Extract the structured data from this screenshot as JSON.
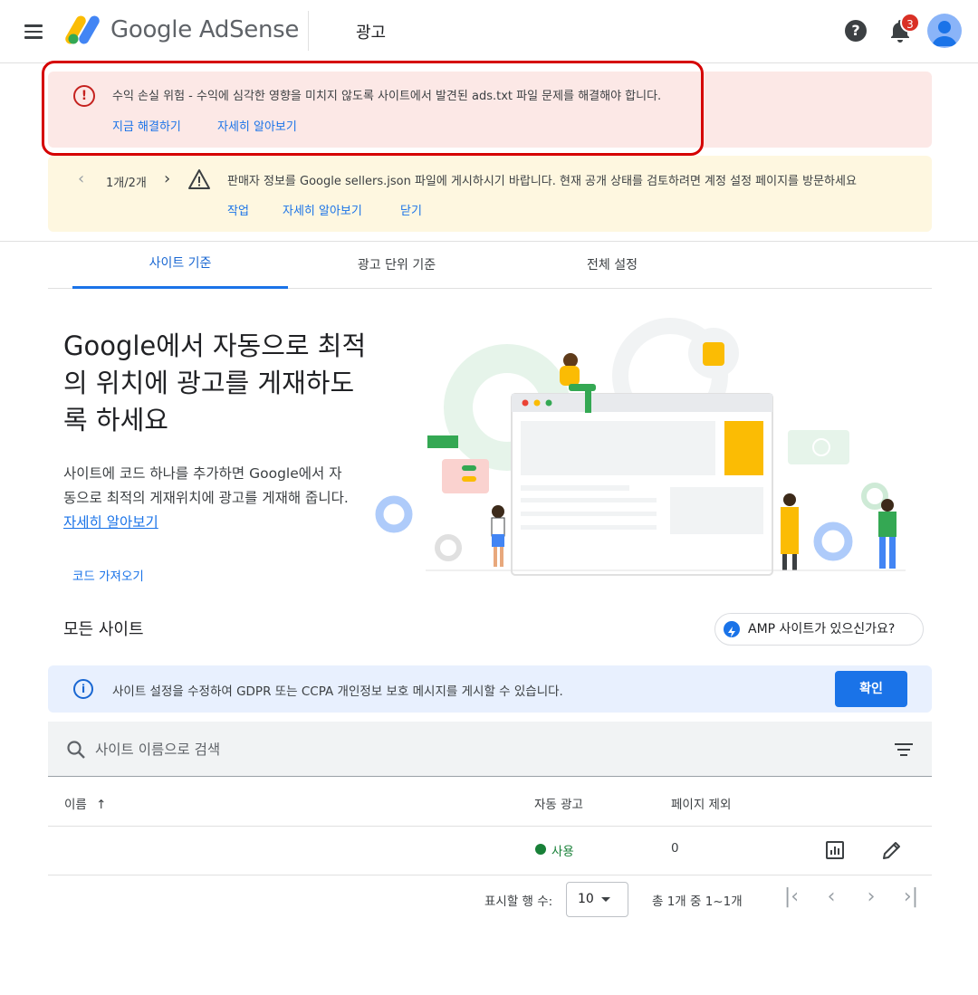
{
  "header": {
    "app_name": "Google AdSense",
    "page_title": "광고",
    "help_icon": "help-circle-icon",
    "notification_count": "3",
    "colors": {
      "logo_yellow": "#fbbc04",
      "logo_blue": "#4285f4",
      "badge_red": "#d93025"
    }
  },
  "alerts": {
    "error": {
      "icon": "error-circle-icon",
      "message": "수익 손실 위험 - 수익에 심각한 영향을 미치지 않도록 사이트에서 발견된 ads.txt 파일 문제를 해결해야 합니다.",
      "fix_link": "지금 해결하기",
      "learn_link": "자세히 알아보기",
      "color": "#fce8e6"
    },
    "warning": {
      "icon": "warning-triangle-icon",
      "pager": "1개/2개",
      "message": "판매자 정보를 Google sellers.json 파일에 게시하시기 바랍니다. 현재 공개 상태를 검토하려면 계정 설정 페이지를 방문하세요",
      "action_link": "작업",
      "learn_link": "자세히 알아보기",
      "close_link": "닫기",
      "color": "#fef7e0"
    }
  },
  "tabs": [
    {
      "label": "사이트 기준",
      "active": true
    },
    {
      "label": "광고 단위 기준",
      "active": false
    },
    {
      "label": "전체 설정",
      "active": false
    }
  ],
  "hero": {
    "title": "Google에서 자동으로 최적의 위치에 광고를 게재하도록 하세요",
    "description": "사이트에 코드 하나를 추가하면 Google에서 자동으로 최적의 게재위치에 광고를 게재해 줍니다.",
    "learn_link": "자세히 알아보기",
    "code_link": "코드 가져오기"
  },
  "sites": {
    "title": "모든 사이트",
    "amp_button": "AMP 사이트가 있으신가요?",
    "info_message": "사이트 설정을 수정하여 GDPR 또는 CCPA 개인정보 보호 메시지를 게시할 수 있습니다.",
    "confirm_button": "확인",
    "search_placeholder": "사이트 이름으로 검색",
    "columns": {
      "name": "이름",
      "auto_ads": "자동 광고",
      "excluded_pages": "페이지 제외"
    },
    "rows": [
      {
        "name": "",
        "auto_ads": "사용",
        "excluded_pages": "0"
      }
    ]
  },
  "pagination": {
    "rows_label": "표시할 행 수:",
    "rows_value": "10",
    "range": "총 1개 중 1~1개"
  }
}
